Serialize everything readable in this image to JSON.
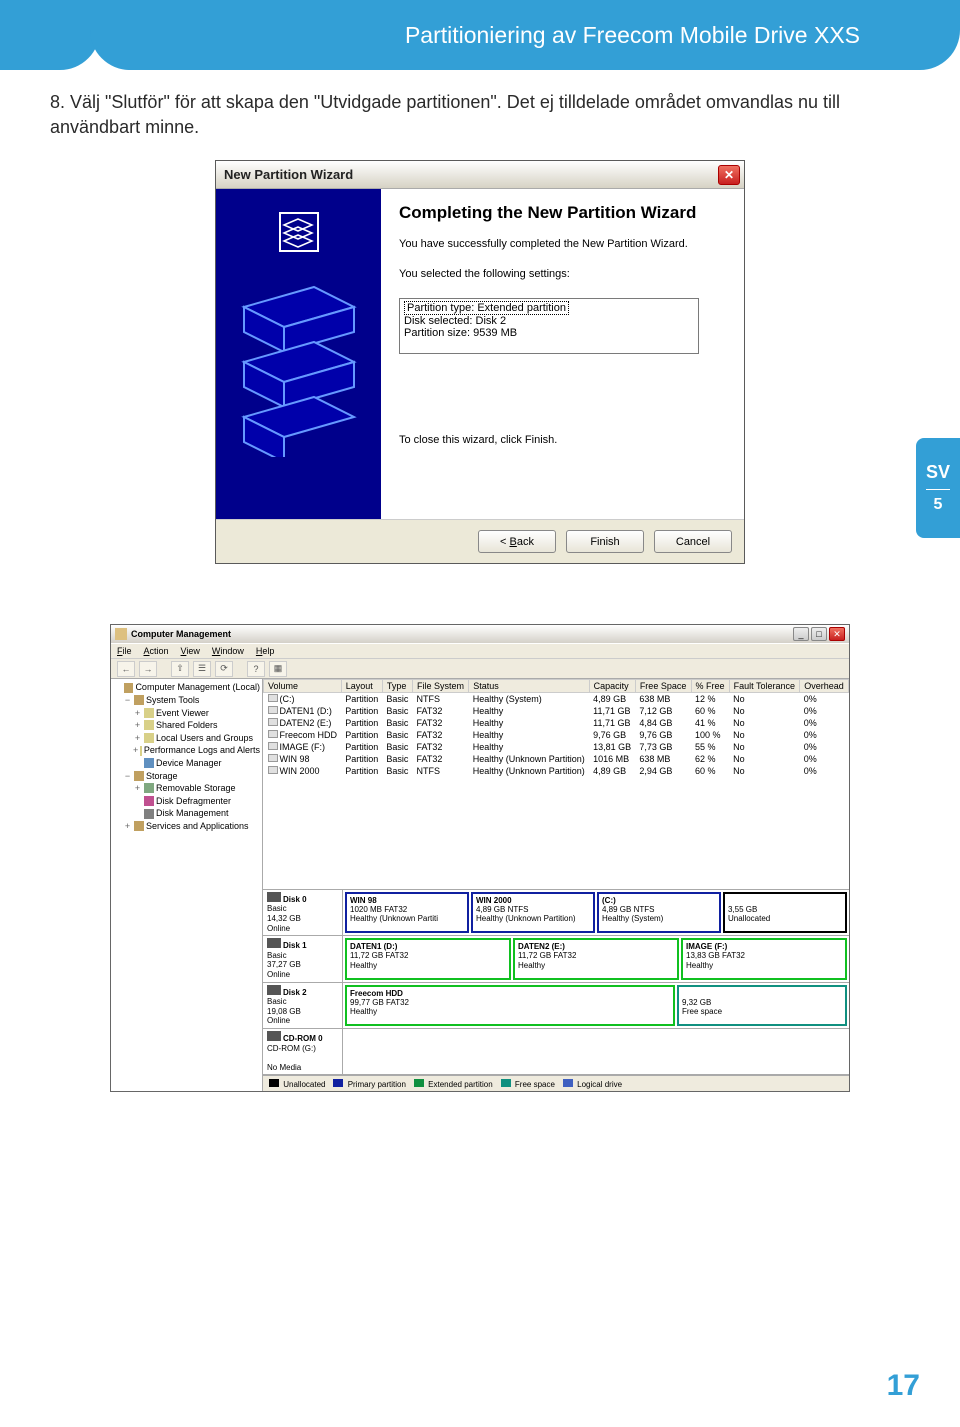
{
  "header": {
    "title": "Partitioniering av Freecom Mobile Drive XXS"
  },
  "body_text": "8. Välj \"Slutför\" för att skapa den \"Utvidgade partitionen\". Det ej tilldelade området omvandlas nu till användbart minne.",
  "wizard": {
    "title": "New Partition Wizard",
    "heading": "Completing the New Partition Wizard",
    "subtext": "You have successfully completed the New Partition Wizard.",
    "settings_label": "You selected the following settings:",
    "settings": [
      "Partition type: Extended partition",
      "Disk selected: Disk 2",
      "Partition size: 9539 MB"
    ],
    "close_line": "To close this wizard, click Finish.",
    "buttons": {
      "back": "< Back",
      "finish": "Finish",
      "cancel": "Cancel"
    }
  },
  "side_tab": {
    "lang": "SV",
    "chapter": "5"
  },
  "cm": {
    "title": "Computer Management",
    "menu": [
      "File",
      "Action",
      "View",
      "Window",
      "Help"
    ],
    "tree": [
      {
        "label": "Computer Management (Local)",
        "indent": 0,
        "exp": "",
        "color": "#c0a060"
      },
      {
        "label": "System Tools",
        "indent": 1,
        "exp": "−",
        "color": "#c0a060"
      },
      {
        "label": "Event Viewer",
        "indent": 2,
        "exp": "+",
        "color": "#d8d088"
      },
      {
        "label": "Shared Folders",
        "indent": 2,
        "exp": "+",
        "color": "#d8d088"
      },
      {
        "label": "Local Users and Groups",
        "indent": 2,
        "exp": "+",
        "color": "#d8d088"
      },
      {
        "label": "Performance Logs and Alerts",
        "indent": 2,
        "exp": "+",
        "color": "#d8d088"
      },
      {
        "label": "Device Manager",
        "indent": 2,
        "exp": "",
        "color": "#6090c0"
      },
      {
        "label": "Storage",
        "indent": 1,
        "exp": "−",
        "color": "#c0a060"
      },
      {
        "label": "Removable Storage",
        "indent": 2,
        "exp": "+",
        "color": "#80a880"
      },
      {
        "label": "Disk Defragmenter",
        "indent": 2,
        "exp": "",
        "color": "#c05090"
      },
      {
        "label": "Disk Management",
        "indent": 2,
        "exp": "",
        "color": "#808080"
      },
      {
        "label": "Services and Applications",
        "indent": 1,
        "exp": "+",
        "color": "#c0a060"
      }
    ],
    "columns": [
      "Volume",
      "Layout",
      "Type",
      "File System",
      "Status",
      "Capacity",
      "Free Space",
      "% Free",
      "Fault Tolerance",
      "Overhead"
    ],
    "volumes": [
      {
        "name": "(C:)",
        "layout": "Partition",
        "type": "Basic",
        "fs": "NTFS",
        "status": "Healthy (System)",
        "cap": "4,89 GB",
        "free": "638 MB",
        "pct": "12 %",
        "ft": "No",
        "ov": "0%"
      },
      {
        "name": "DATEN1 (D:)",
        "layout": "Partition",
        "type": "Basic",
        "fs": "FAT32",
        "status": "Healthy",
        "cap": "11,71 GB",
        "free": "7,12 GB",
        "pct": "60 %",
        "ft": "No",
        "ov": "0%"
      },
      {
        "name": "DATEN2 (E:)",
        "layout": "Partition",
        "type": "Basic",
        "fs": "FAT32",
        "status": "Healthy",
        "cap": "11,71 GB",
        "free": "4,84 GB",
        "pct": "41 %",
        "ft": "No",
        "ov": "0%"
      },
      {
        "name": "Freecom HDD",
        "layout": "Partition",
        "type": "Basic",
        "fs": "FAT32",
        "status": "Healthy",
        "cap": "9,76 GB",
        "free": "9,76 GB",
        "pct": "100 %",
        "ft": "No",
        "ov": "0%"
      },
      {
        "name": "IMAGE (F:)",
        "layout": "Partition",
        "type": "Basic",
        "fs": "FAT32",
        "status": "Healthy",
        "cap": "13,81 GB",
        "free": "7,73 GB",
        "pct": "55 %",
        "ft": "No",
        "ov": "0%"
      },
      {
        "name": "WIN 98",
        "layout": "Partition",
        "type": "Basic",
        "fs": "FAT32",
        "status": "Healthy (Unknown Partition)",
        "cap": "1016 MB",
        "free": "638 MB",
        "pct": "62 %",
        "ft": "No",
        "ov": "0%"
      },
      {
        "name": "WIN 2000",
        "layout": "Partition",
        "type": "Basic",
        "fs": "NTFS",
        "status": "Healthy (Unknown Partition)",
        "cap": "4,89 GB",
        "free": "2,94 GB",
        "pct": "60 %",
        "ft": "No",
        "ov": "0%"
      }
    ],
    "disks": [
      {
        "name": "Disk 0",
        "type": "Basic",
        "size": "14,32 GB",
        "status": "Online",
        "parts": [
          {
            "title": "WIN 98",
            "l2": "1020 MB FAT32",
            "l3": "Healthy (Unknown Partiti",
            "cls": "blue"
          },
          {
            "title": "WIN 2000",
            "l2": "4,89 GB NTFS",
            "l3": "Healthy (Unknown Partition)",
            "cls": "blue"
          },
          {
            "title": "(C:)",
            "l2": "4,89 GB NTFS",
            "l3": "Healthy (System)",
            "cls": "blue"
          },
          {
            "title": "",
            "l2": "3,55 GB",
            "l3": "Unallocated",
            "cls": "black"
          }
        ]
      },
      {
        "name": "Disk 1",
        "type": "Basic",
        "size": "37,27 GB",
        "status": "Online",
        "parts": [
          {
            "title": "DATEN1 (D:)",
            "l2": "11,72 GB FAT32",
            "l3": "Healthy",
            "cls": "green"
          },
          {
            "title": "DATEN2 (E:)",
            "l2": "11,72 GB FAT32",
            "l3": "Healthy",
            "cls": "green"
          },
          {
            "title": "IMAGE (F:)",
            "l2": "13,83 GB FAT32",
            "l3": "Healthy",
            "cls": "green"
          }
        ]
      },
      {
        "name": "Disk 2",
        "type": "Basic",
        "size": "19,08 GB",
        "status": "Online",
        "parts": [
          {
            "title": "Freecom HDD",
            "l2": "99,77 GB FAT32",
            "l3": "Healthy",
            "cls": "green",
            "flex": 2
          },
          {
            "title": "",
            "l2": "9,32 GB",
            "l3": "Free space",
            "cls": "teal",
            "flex": 1
          }
        ]
      },
      {
        "name": "CD-ROM 0",
        "type": "CD-ROM (G:)",
        "size": "",
        "status": "No Media",
        "parts": []
      }
    ],
    "legend": [
      {
        "label": "Unallocated",
        "color": "#000000"
      },
      {
        "label": "Primary partition",
        "color": "#1020a0"
      },
      {
        "label": "Extended partition",
        "color": "#109040"
      },
      {
        "label": "Free space",
        "color": "#109080"
      },
      {
        "label": "Logical drive",
        "color": "#4060c0"
      }
    ]
  },
  "page_number": "17"
}
